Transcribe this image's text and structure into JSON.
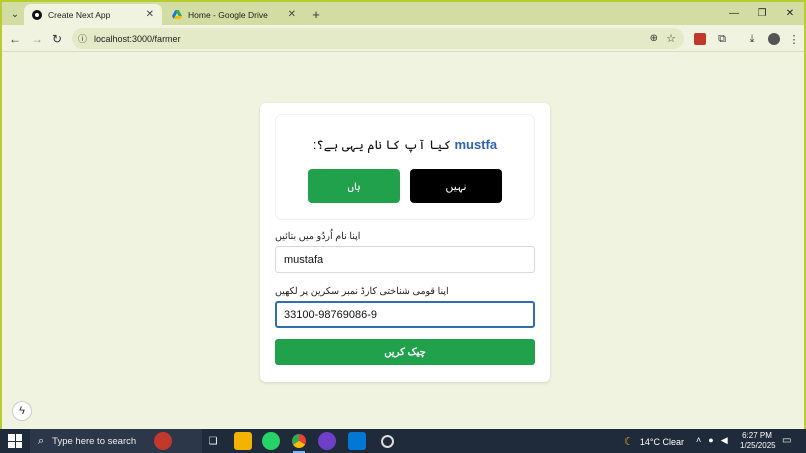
{
  "browser": {
    "tabs": [
      {
        "title": "Create Next App",
        "active": true
      },
      {
        "title": "Home - Google Drive",
        "active": false
      }
    ],
    "url": "localhost:3000/farmer"
  },
  "card": {
    "question_name": "mustfa",
    "question_text": ":کیا آپ کا نام یہی ہے؟",
    "yes_label": "ہاں",
    "no_label": "نہیں",
    "name_label": "اپنا نام اُردُو میں بتائیں",
    "name_value": "mustafa",
    "cnic_label": "اپنا قومی شناختی کارڈ نمبر سکرین پر لکھیں",
    "cnic_value": "33100-98769086-9",
    "check_label": "چیک کریں"
  },
  "taskbar": {
    "search_placeholder": "Type here to search",
    "weather": "14°C  Clear",
    "time": "6:27 PM",
    "date": "1/25/2025"
  },
  "colors": {
    "green": "#21a14b",
    "black": "#000000",
    "name_blue": "#2f63b5",
    "focus_border": "#2f6fb0"
  }
}
